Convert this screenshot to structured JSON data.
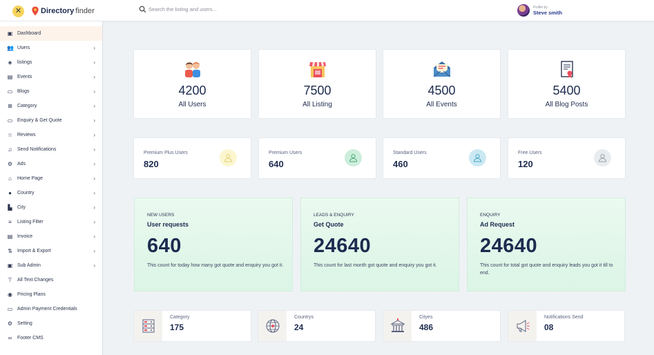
{
  "header": {
    "logo_bold": "Directory",
    "logo_light": "finder",
    "search_placeholder": "Search the listing and users...",
    "profile_caption": "Profile by",
    "profile_name": "Steve smith"
  },
  "sidebar": {
    "items": [
      {
        "label": "Dashboard",
        "icon": "dashboard-icon",
        "chevron": false
      },
      {
        "label": "Users",
        "icon": "users-icon",
        "chevron": true
      },
      {
        "label": "listings",
        "icon": "layers-icon",
        "chevron": true
      },
      {
        "label": "Events",
        "icon": "events-icon",
        "chevron": true
      },
      {
        "label": "Blogs",
        "icon": "blog-icon",
        "chevron": true
      },
      {
        "label": "Category",
        "icon": "grid-icon",
        "chevron": true
      },
      {
        "label": "Enquiry & Get Quote",
        "icon": "enquiry-icon",
        "chevron": true
      },
      {
        "label": "Reviews",
        "icon": "star-icon",
        "chevron": true
      },
      {
        "label": "Send Notifications",
        "icon": "bell-icon",
        "chevron": true
      },
      {
        "label": "Ads",
        "icon": "gear-icon",
        "chevron": true
      },
      {
        "label": "Home Page",
        "icon": "home-icon",
        "chevron": true
      },
      {
        "label": "Country",
        "icon": "location-pin-icon",
        "chevron": true
      },
      {
        "label": "City",
        "icon": "city-icon",
        "chevron": true
      },
      {
        "label": "Listing Filter",
        "icon": "filter-icon",
        "chevron": true
      },
      {
        "label": "Invoice",
        "icon": "invoice-icon",
        "chevron": true
      },
      {
        "label": "Import & Export",
        "icon": "import-export-icon",
        "chevron": true
      },
      {
        "label": "Sub Admin",
        "icon": "sub-admin-icon",
        "chevron": true
      },
      {
        "label": "All Text Changes",
        "icon": "text-icon",
        "chevron": false
      },
      {
        "label": "Pricing Plans",
        "icon": "pricing-icon",
        "chevron": false
      },
      {
        "label": "Admin Payment Credentials",
        "icon": "payment-icon",
        "chevron": false
      },
      {
        "label": "Setting",
        "icon": "settings-icon",
        "chevron": false
      },
      {
        "label": "Footer CMS",
        "icon": "link-icon",
        "chevron": false
      }
    ]
  },
  "stats": [
    {
      "value": "4200",
      "label": "All Users",
      "icon": "users-icon"
    },
    {
      "value": "7500",
      "label": "All Listing",
      "icon": "store-icon"
    },
    {
      "value": "4500",
      "label": "All Events",
      "icon": "envelope-icon"
    },
    {
      "value": "5400",
      "label": "All Blog Posts",
      "icon": "document-icon"
    }
  ],
  "user_types": [
    {
      "label": "Premium Plus Users",
      "value": "820",
      "color": "#fbf6cf",
      "icon_color": "#e7d98a"
    },
    {
      "label": "Premium Users",
      "value": "640",
      "color": "#cdeedc",
      "icon_color": "#57b987"
    },
    {
      "label": "Standard Users",
      "value": "460",
      "color": "#cbe9f3",
      "icon_color": "#58b3d0"
    },
    {
      "label": "Free Users",
      "value": "120",
      "color": "#e9ecef",
      "icon_color": "#a6adb5"
    }
  ],
  "highlights": [
    {
      "eyebrow": "NEW USERS",
      "title": "User requests",
      "value": "640",
      "desc": "This count for today how many got quote and enquiry you got it."
    },
    {
      "eyebrow": "LEADS & ENQUIRY",
      "title": "Get Quote",
      "value": "24640",
      "desc": "This count for last month got quote and enquiry you got it."
    },
    {
      "eyebrow": "ENQUIRY",
      "title": "Ad Request",
      "value": "24640",
      "desc": "This count for total got quote and enquiry leads you got it till to end."
    }
  ],
  "bottom": [
    {
      "label": "Category",
      "value": "175",
      "icon": "category-icon"
    },
    {
      "label": "Countrys",
      "value": "24",
      "icon": "globe-icon"
    },
    {
      "label": "Cityes",
      "value": "486",
      "icon": "building-icon"
    },
    {
      "label": "Notifications Send",
      "value": "08",
      "icon": "megaphone-icon"
    }
  ]
}
